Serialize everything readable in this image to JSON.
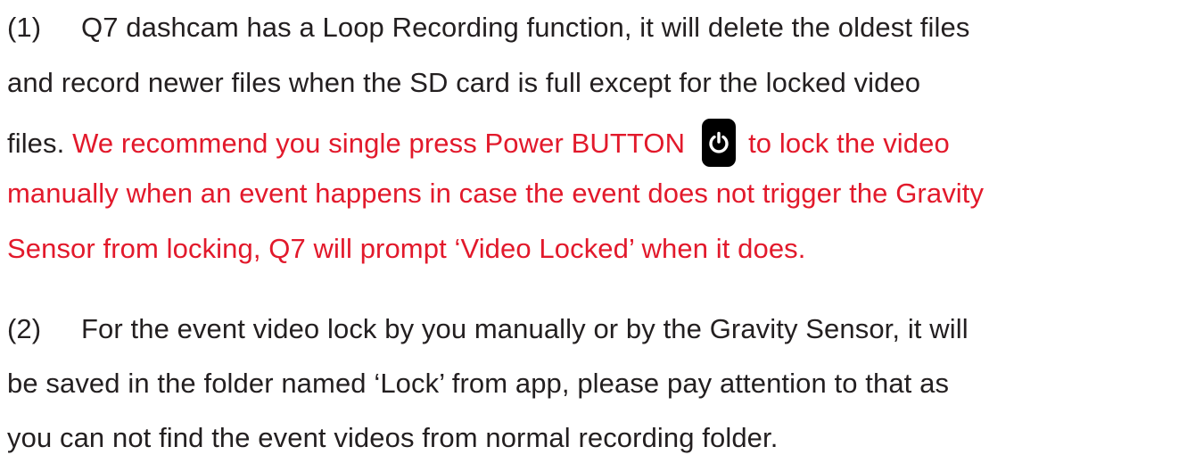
{
  "paragraph1": {
    "number": "(1)",
    "line1_text": "Q7 dashcam has a Loop Recording function, it will delete the oldest files",
    "line2_text": "and record newer files when the SD card is full except for the locked video",
    "line3_black": "files. ",
    "line3_red_before": "We recommend you single press Power BUTTON",
    "line3_red_after": "to lock the video",
    "line4_red": "manually when an event happens in case the event does not trigger the Gravity",
    "line5_red": "Sensor from locking, Q7 will prompt ‘Video Locked’ when it does.",
    "icon": "power-icon",
    "highlight_color": "#e2192b"
  },
  "paragraph2": {
    "number": "(2)",
    "line1_text": "For the event video lock by you manually or by the Gravity Sensor, it will",
    "line2_text": "be saved in the folder named ‘Lock’ from app, please pay attention to that as",
    "line3_text": "you can not find the event videos from normal recording folder."
  }
}
